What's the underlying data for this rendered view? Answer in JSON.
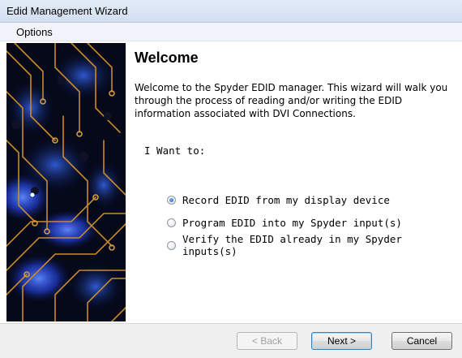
{
  "window": {
    "title": "Edid Management Wizard"
  },
  "menu": {
    "options_label": "Options"
  },
  "page": {
    "heading": "Welcome",
    "intro_lines": [
      "Welcome to the Spyder EDID manager.  This wizard will walk you",
      "through the process of reading and/or writing the EDID",
      "information associated with DVI Connections."
    ],
    "prompt": "I Want to:",
    "options": [
      {
        "label": "Record EDID from my display device",
        "checked": true
      },
      {
        "label": "Program EDID into my Spyder input(s)",
        "checked": false
      },
      {
        "label": "Verify the EDID already in my Spyder inputs(s)",
        "checked": false
      }
    ]
  },
  "buttons": {
    "back": "< Back",
    "next": "Next >",
    "cancel": "Cancel"
  },
  "colors": {
    "side_background": "#05091a",
    "trace": "#c98a2a",
    "glow": "#2b55ff"
  }
}
